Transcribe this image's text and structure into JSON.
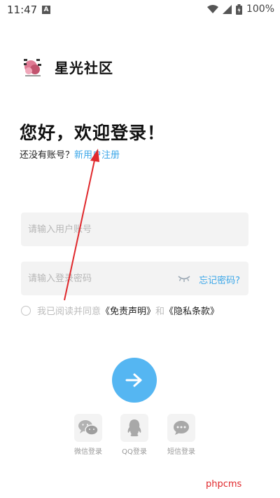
{
  "status_bar": {
    "time": "11:47",
    "notif_letter": "A",
    "battery": "100%"
  },
  "brand": {
    "name": "星光社区"
  },
  "login": {
    "welcome": "您好，欢迎登录！",
    "no_account_text": "还没有账号？",
    "register_link": "新用户注册",
    "account_placeholder": "请输入用户账号",
    "password_placeholder": "请输入登录密码",
    "forgot_password": "忘记密码?",
    "agree_prefix": "我已阅读并同意",
    "disclaimer_link": "《免责声明》",
    "agree_and": "和",
    "privacy_link": "《隐私条款》"
  },
  "social": {
    "wechat_label": "微信登录",
    "qq_label": "QQ登录",
    "sms_label": "短信登录"
  },
  "watermark": "phpcms",
  "colors": {
    "accent": "#3aa6e8",
    "submit_button": "#55b6f2",
    "annotation_arrow": "#e0282c"
  }
}
